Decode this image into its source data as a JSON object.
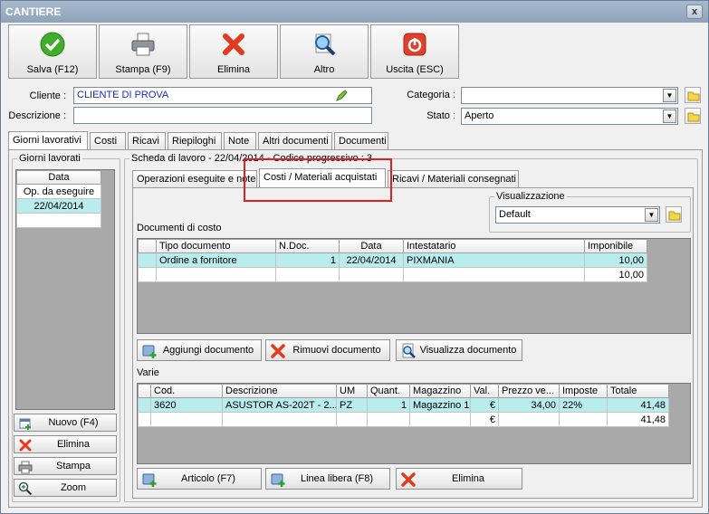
{
  "window": {
    "title": "CANTIERE",
    "close_glyph": "x"
  },
  "toolbar": [
    {
      "label": "Salva (F12)",
      "icon": "check-icon"
    },
    {
      "label": "Stampa (F9)",
      "icon": "printer-icon"
    },
    {
      "label": "Elimina",
      "icon": "delete-x-icon"
    },
    {
      "label": "Altro",
      "icon": "magnifier-icon"
    },
    {
      "label": "Uscita (ESC)",
      "icon": "power-icon"
    }
  ],
  "form": {
    "cliente_label": "Cliente :",
    "cliente_value": "CLIENTE DI PROVA",
    "descrizione_label": "Descrizione :",
    "descrizione_value": "",
    "categoria_label": "Categoria :",
    "categoria_value": "",
    "stato_label": "Stato :",
    "stato_value": "Aperto"
  },
  "main_tabs": [
    "Giorni lavorativi",
    "Costi",
    "Ricavi",
    "Riepiloghi",
    "Note",
    "Altri documenti",
    "Documenti"
  ],
  "giorni": {
    "group_title": "Giorni lavorati",
    "header": "Data",
    "rows": [
      "Op. da eseguire",
      "22/04/2014"
    ],
    "buttons": [
      "Nuovo (F4)",
      "Elimina",
      "Stampa",
      "Zoom"
    ]
  },
  "scheda": {
    "title": "Scheda di lavoro - 22/04/2014 - Codice progressivo : 3",
    "tabs": [
      "Operazioni eseguite e note",
      "Costi / Materiali acquistati",
      "Ricavi / Materiali consegnati"
    ],
    "visualizzazione_label": "Visualizzazione",
    "visualizzazione_value": "Default",
    "documenti_label": "Documenti di costo",
    "doc_columns": [
      "Tipo documento",
      "N.Doc.",
      "Data",
      "Intestatario",
      "Imponibile"
    ],
    "doc_rows": [
      [
        "Ordine a fornitore",
        "1",
        "22/04/2014",
        "PIXMANIA",
        "10,00"
      ],
      [
        "",
        "",
        "",
        "",
        "10,00"
      ]
    ],
    "doc_buttons": [
      "Aggiungi documento",
      "Rimuovi documento",
      "Visualizza documento"
    ],
    "varie_label": "Varie",
    "varie_columns": [
      "Cod.",
      "Descrizione",
      "UM",
      "Quant.",
      "Magazzino",
      "Val.",
      "Prezzo ve...",
      "Imposte",
      "Totale"
    ],
    "varie_rows": [
      [
        "3620",
        "ASUSTOR AS-202T - 2...",
        "PZ",
        "1",
        "Magazzino 1",
        "€",
        "34,00",
        "22%",
        "41,48"
      ],
      [
        "",
        "",
        "",
        "",
        "",
        "€",
        "",
        "",
        "41,48"
      ]
    ],
    "varie_buttons": [
      "Articolo (F7)",
      "Linea libera (F8)",
      "Elimina"
    ]
  }
}
